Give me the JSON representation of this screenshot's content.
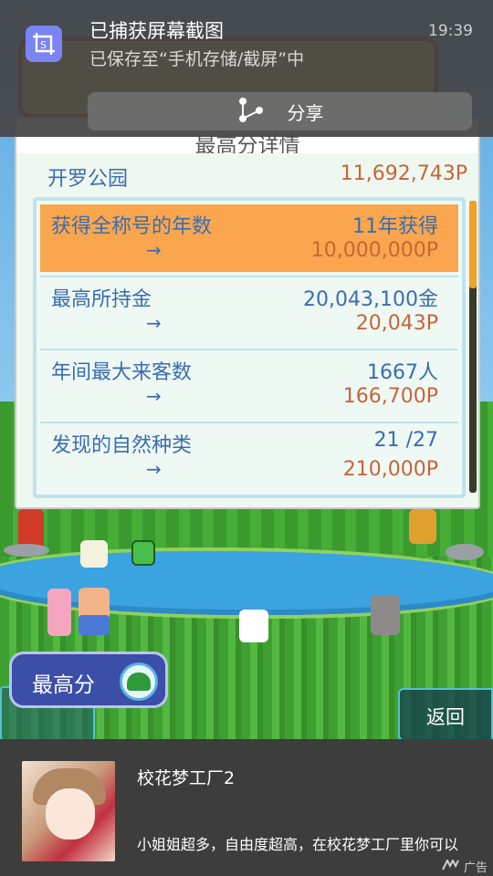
{
  "notification": {
    "title": "已捕获屏幕截图",
    "subtitle": "已保存至“手机存储/截屏”中",
    "time": "19:39",
    "icon": "screenshot-icon",
    "share_label": "分享",
    "share_icon": "share-icon"
  },
  "dialog": {
    "title": "最高分详情",
    "park_name": "开罗公园",
    "park_score": "11,692,743P",
    "items": [
      {
        "label": "获得全称号的年数",
        "value": "11年获得",
        "arrow": "→",
        "reward": "10,000,000P",
        "highlighted": true
      },
      {
        "label": "最高所持金",
        "value": "20,043,100金",
        "arrow": "→",
        "reward": "20,043P",
        "highlighted": false
      },
      {
        "label": "年间最大来客数",
        "value": "1667人",
        "arrow": "→",
        "reward": "166,700P",
        "highlighted": false
      },
      {
        "label": "发现的自然种类",
        "value": "21 /27",
        "arrow": "→",
        "reward": "210,000P",
        "highlighted": false
      }
    ]
  },
  "buttons": {
    "highscore_label": "最高分",
    "highscore_icon": "tree-icon",
    "back_label": "返回"
  },
  "ad": {
    "title": "校花梦工厂2",
    "description": "小姐姐超多，自由度超高，在校花梦工厂里你可以",
    "tag": "广告",
    "tag_icon": "ad-logo-icon"
  },
  "colors": {
    "accent_orange": "#f9a64e",
    "label_blue": "#3a6db0",
    "reward_orange": "#c8643a",
    "highscore_button": "#3b4ea8"
  }
}
